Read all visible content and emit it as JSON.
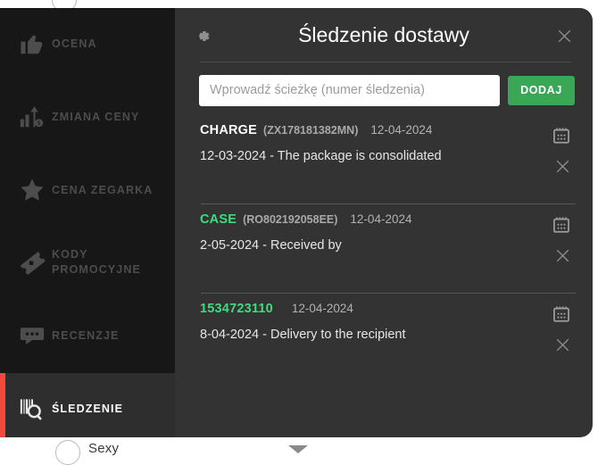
{
  "colors": {
    "accent_red": "#f4483f",
    "accent_green": "#3aa757",
    "code_green": "#3ddc7f",
    "panel_bg": "#333333",
    "sidebar_bg": "#2b2b2b"
  },
  "background_page": {
    "bottom_option_label": "Sexy"
  },
  "sidebar": {
    "items": [
      {
        "label": "OCENA",
        "icon": "thumbs-up-icon",
        "active": false
      },
      {
        "label": "ZMIANA CENY",
        "icon": "price-change-icon",
        "active": false
      },
      {
        "label": "CENA ZEGARKA",
        "icon": "star-icon",
        "active": false
      },
      {
        "label": "KODY PROMOCYJNE",
        "icon": "ticket-icon",
        "active": false
      },
      {
        "label": "RECENZJE",
        "icon": "comment-icon",
        "active": false
      },
      {
        "label": "ŚLEDZENIE",
        "icon": "barcode-search-icon",
        "active": true
      }
    ]
  },
  "panel": {
    "title": "Śledzenie dostawy",
    "settings_icon": "gear-icon",
    "close_icon": "close-icon",
    "search": {
      "placeholder": "Wprowadź ścieżkę (numer śledzenia)",
      "value": "",
      "add_label": "DODAJ"
    },
    "entries": [
      {
        "code": "CHARGE",
        "code_color": "white",
        "reference": "(ZX178181382MN)",
        "date": "12-04-2024",
        "status": "12-03-2024 - The package is consolidated",
        "calendar_icon": "calendar-icon",
        "delete_icon": "close-icon"
      },
      {
        "code": "CASE",
        "code_color": "green",
        "reference": "(RO802192058EE)",
        "date": "12-04-2024",
        "status": "2-05-2024 - Received by",
        "calendar_icon": "calendar-icon",
        "delete_icon": "close-icon"
      },
      {
        "code": "1534723110",
        "code_color": "green",
        "reference": "",
        "date": "12-04-2024",
        "status": "8-04-2024 - Delivery to the recipient",
        "calendar_icon": "calendar-icon",
        "delete_icon": "close-icon"
      }
    ]
  }
}
